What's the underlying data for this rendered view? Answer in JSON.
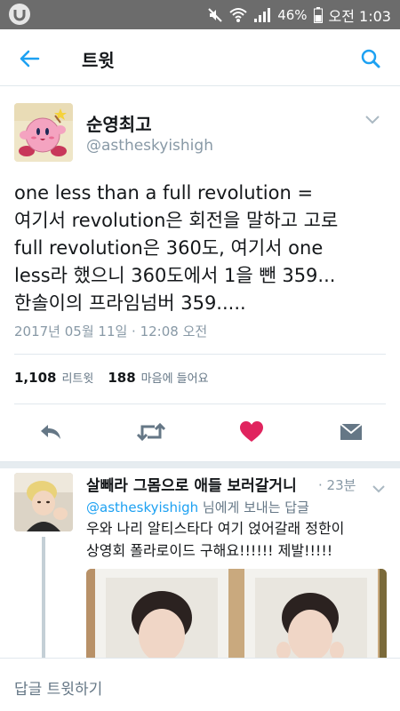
{
  "status_bar": {
    "battery": "46%",
    "time": "오전 1:03"
  },
  "header": {
    "title": "트윗"
  },
  "tweet": {
    "author_name": "순영최고",
    "author_handle": "@astheskyishigh",
    "text_lines": [
      "one less than a full revolution =",
      "여기서 revolution은 회전을 말하고 고로",
      "full revolution은 360도, 여기서 one",
      "less라 했으니 360도에서 1을 뺀 359...",
      "한솔이의 프라임넘버 359....."
    ],
    "date": "2017년 05월 11일 · 12:08 오전",
    "retweet_count": "1,108",
    "retweet_label": "리트윗",
    "like_count": "188",
    "like_label": "마음에 들어요"
  },
  "reply": {
    "author_name": "살빼라 그몸으로 애들 보러갈거니",
    "time": "· 23분",
    "reply_to_handle": "@astheskyishigh",
    "reply_to_suffix": " 님에게 보내는 답글",
    "text_lines": [
      "우와 나리 알티스타다 여기 얹어갈래 정한이",
      "상영회 폴라로이드 구해요!!!!!! 제발!!!!!"
    ]
  },
  "compose": {
    "placeholder": "답글 트윗하기"
  },
  "colors": {
    "accent": "#1da1f2",
    "like": "#e0245e",
    "secondary_text": "#8899a6",
    "status_bar": "#6c6c6c"
  },
  "icons": {
    "back": "arrow-left-icon",
    "search": "search-icon",
    "reply": "reply-icon",
    "retweet": "retweet-icon",
    "like": "heart-icon",
    "dm": "direct-message-icon"
  }
}
